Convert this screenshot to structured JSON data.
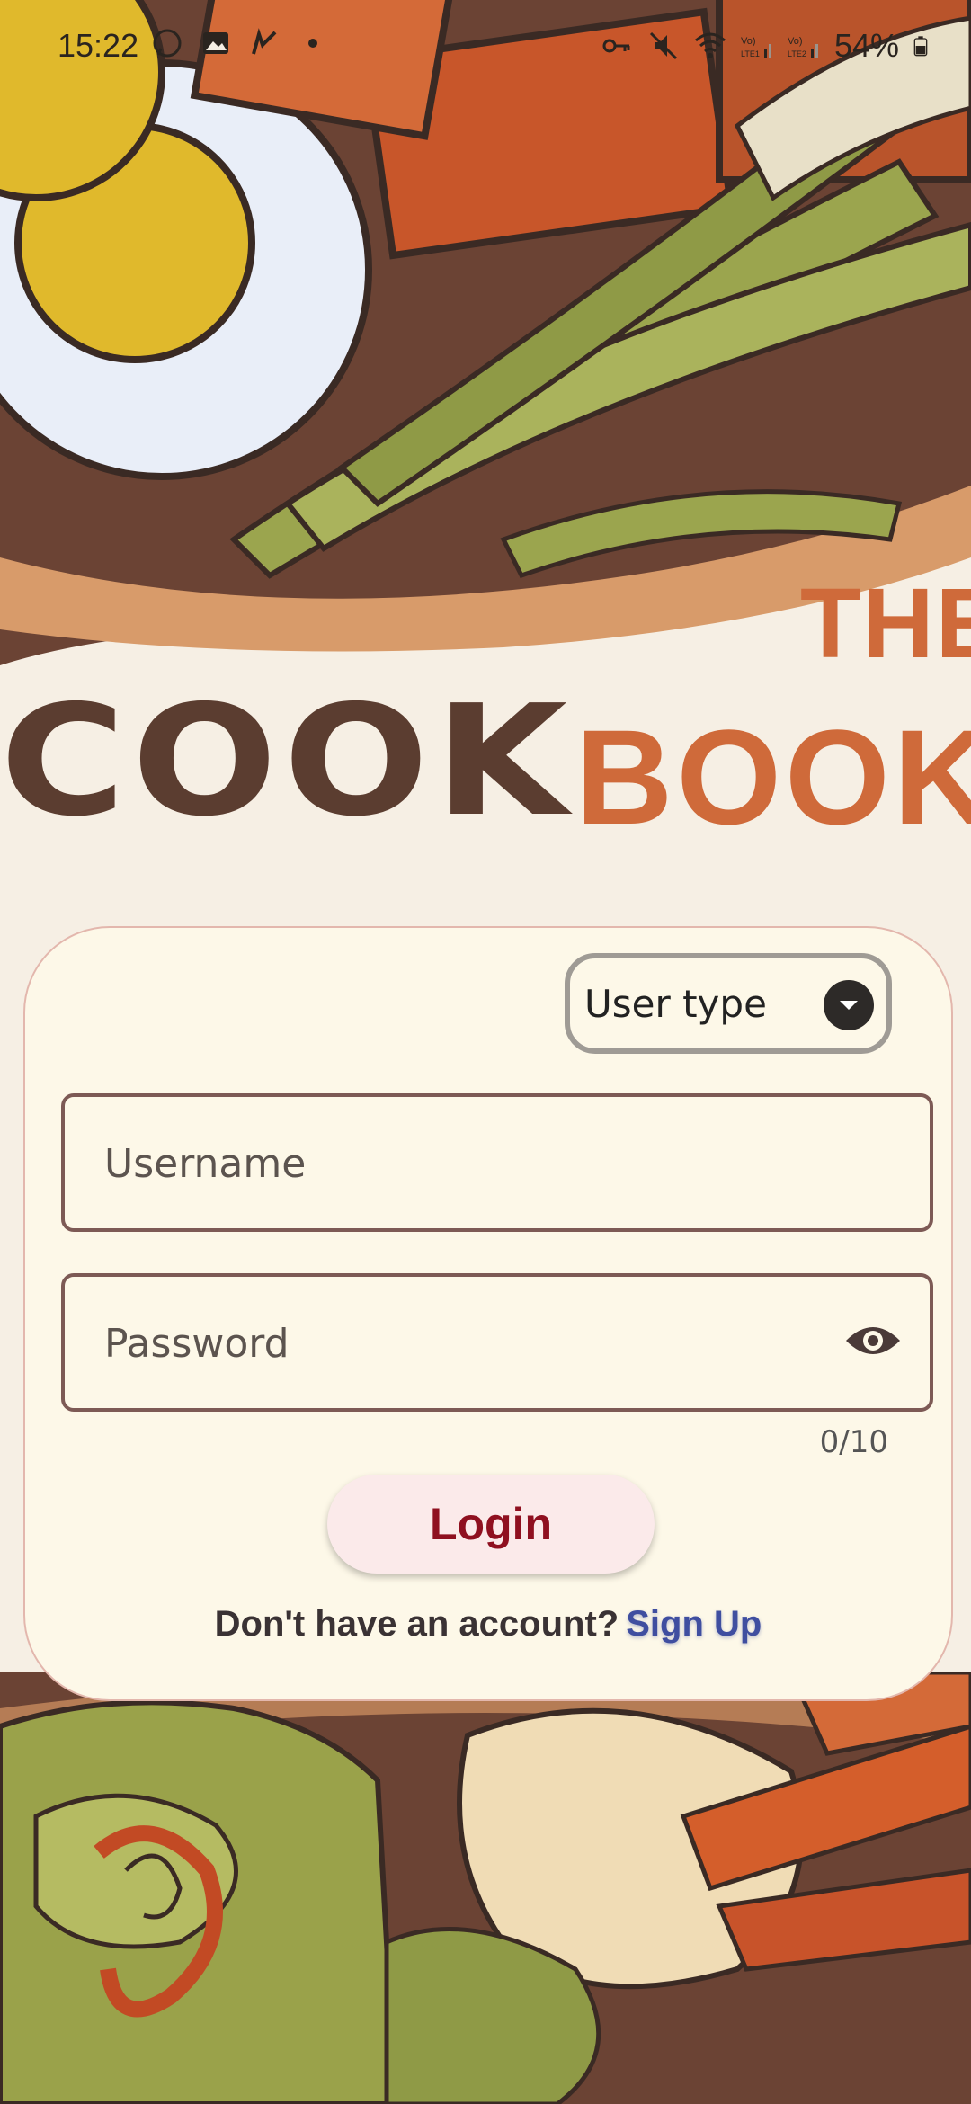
{
  "status_bar": {
    "time": "15:22",
    "battery": "54%",
    "left_icons": [
      "whatsapp-icon",
      "gallery-icon",
      "check-icon",
      "dot-icon"
    ],
    "right_icons": [
      "vpn-key-icon",
      "mute-icon",
      "wifi-icon",
      "volte1-signal-icon",
      "volte2-signal-icon",
      "battery-icon"
    ]
  },
  "brand": {
    "the": "THE",
    "cook": "COOK",
    "book": "BOOK"
  },
  "login_form": {
    "user_type_label": "User type",
    "username_placeholder": "Username",
    "password_placeholder": "Password",
    "password_counter": "0/10",
    "login_label": "Login",
    "signup_prompt": "Don't have an account?",
    "signup_link": "Sign Up"
  },
  "colors": {
    "accent_orange": "#cf6a3a",
    "brand_brown": "#5b3d30",
    "login_text": "#8f1020",
    "link_blue": "#3f4ea0",
    "card_background": "#fdf8e8"
  }
}
